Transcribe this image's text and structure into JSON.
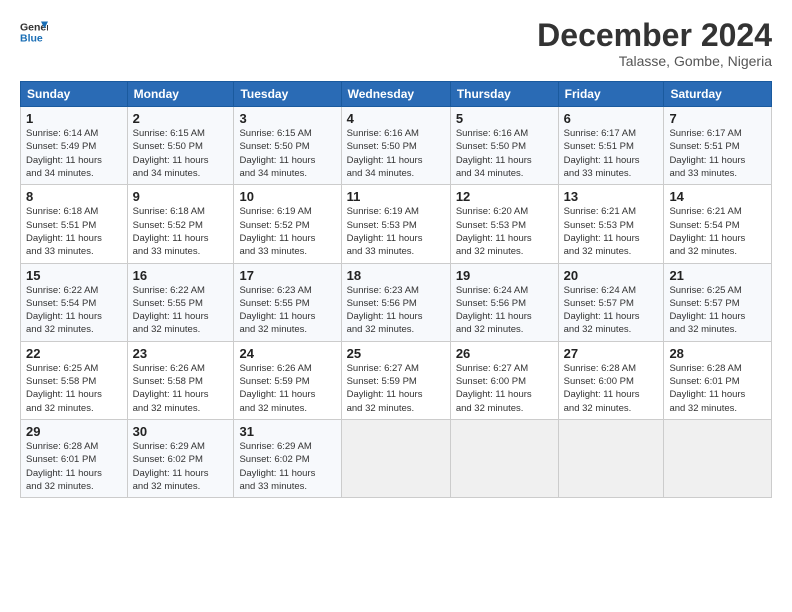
{
  "logo": {
    "line1": "General",
    "line2": "Blue"
  },
  "title": "December 2024",
  "subtitle": "Talasse, Gombe, Nigeria",
  "days_of_week": [
    "Sunday",
    "Monday",
    "Tuesday",
    "Wednesday",
    "Thursday",
    "Friday",
    "Saturday"
  ],
  "weeks": [
    [
      {
        "day": "1",
        "info": "Sunrise: 6:14 AM\nSunset: 5:49 PM\nDaylight: 11 hours\nand 34 minutes."
      },
      {
        "day": "2",
        "info": "Sunrise: 6:15 AM\nSunset: 5:50 PM\nDaylight: 11 hours\nand 34 minutes."
      },
      {
        "day": "3",
        "info": "Sunrise: 6:15 AM\nSunset: 5:50 PM\nDaylight: 11 hours\nand 34 minutes."
      },
      {
        "day": "4",
        "info": "Sunrise: 6:16 AM\nSunset: 5:50 PM\nDaylight: 11 hours\nand 34 minutes."
      },
      {
        "day": "5",
        "info": "Sunrise: 6:16 AM\nSunset: 5:50 PM\nDaylight: 11 hours\nand 34 minutes."
      },
      {
        "day": "6",
        "info": "Sunrise: 6:17 AM\nSunset: 5:51 PM\nDaylight: 11 hours\nand 33 minutes."
      },
      {
        "day": "7",
        "info": "Sunrise: 6:17 AM\nSunset: 5:51 PM\nDaylight: 11 hours\nand 33 minutes."
      }
    ],
    [
      {
        "day": "8",
        "info": "Sunrise: 6:18 AM\nSunset: 5:51 PM\nDaylight: 11 hours\nand 33 minutes."
      },
      {
        "day": "9",
        "info": "Sunrise: 6:18 AM\nSunset: 5:52 PM\nDaylight: 11 hours\nand 33 minutes."
      },
      {
        "day": "10",
        "info": "Sunrise: 6:19 AM\nSunset: 5:52 PM\nDaylight: 11 hours\nand 33 minutes."
      },
      {
        "day": "11",
        "info": "Sunrise: 6:19 AM\nSunset: 5:53 PM\nDaylight: 11 hours\nand 33 minutes."
      },
      {
        "day": "12",
        "info": "Sunrise: 6:20 AM\nSunset: 5:53 PM\nDaylight: 11 hours\nand 32 minutes."
      },
      {
        "day": "13",
        "info": "Sunrise: 6:21 AM\nSunset: 5:53 PM\nDaylight: 11 hours\nand 32 minutes."
      },
      {
        "day": "14",
        "info": "Sunrise: 6:21 AM\nSunset: 5:54 PM\nDaylight: 11 hours\nand 32 minutes."
      }
    ],
    [
      {
        "day": "15",
        "info": "Sunrise: 6:22 AM\nSunset: 5:54 PM\nDaylight: 11 hours\nand 32 minutes."
      },
      {
        "day": "16",
        "info": "Sunrise: 6:22 AM\nSunset: 5:55 PM\nDaylight: 11 hours\nand 32 minutes."
      },
      {
        "day": "17",
        "info": "Sunrise: 6:23 AM\nSunset: 5:55 PM\nDaylight: 11 hours\nand 32 minutes."
      },
      {
        "day": "18",
        "info": "Sunrise: 6:23 AM\nSunset: 5:56 PM\nDaylight: 11 hours\nand 32 minutes."
      },
      {
        "day": "19",
        "info": "Sunrise: 6:24 AM\nSunset: 5:56 PM\nDaylight: 11 hours\nand 32 minutes."
      },
      {
        "day": "20",
        "info": "Sunrise: 6:24 AM\nSunset: 5:57 PM\nDaylight: 11 hours\nand 32 minutes."
      },
      {
        "day": "21",
        "info": "Sunrise: 6:25 AM\nSunset: 5:57 PM\nDaylight: 11 hours\nand 32 minutes."
      }
    ],
    [
      {
        "day": "22",
        "info": "Sunrise: 6:25 AM\nSunset: 5:58 PM\nDaylight: 11 hours\nand 32 minutes."
      },
      {
        "day": "23",
        "info": "Sunrise: 6:26 AM\nSunset: 5:58 PM\nDaylight: 11 hours\nand 32 minutes."
      },
      {
        "day": "24",
        "info": "Sunrise: 6:26 AM\nSunset: 5:59 PM\nDaylight: 11 hours\nand 32 minutes."
      },
      {
        "day": "25",
        "info": "Sunrise: 6:27 AM\nSunset: 5:59 PM\nDaylight: 11 hours\nand 32 minutes."
      },
      {
        "day": "26",
        "info": "Sunrise: 6:27 AM\nSunset: 6:00 PM\nDaylight: 11 hours\nand 32 minutes."
      },
      {
        "day": "27",
        "info": "Sunrise: 6:28 AM\nSunset: 6:00 PM\nDaylight: 11 hours\nand 32 minutes."
      },
      {
        "day": "28",
        "info": "Sunrise: 6:28 AM\nSunset: 6:01 PM\nDaylight: 11 hours\nand 32 minutes."
      }
    ],
    [
      {
        "day": "29",
        "info": "Sunrise: 6:28 AM\nSunset: 6:01 PM\nDaylight: 11 hours\nand 32 minutes."
      },
      {
        "day": "30",
        "info": "Sunrise: 6:29 AM\nSunset: 6:02 PM\nDaylight: 11 hours\nand 32 minutes."
      },
      {
        "day": "31",
        "info": "Sunrise: 6:29 AM\nSunset: 6:02 PM\nDaylight: 11 hours\nand 33 minutes."
      },
      null,
      null,
      null,
      null
    ]
  ]
}
